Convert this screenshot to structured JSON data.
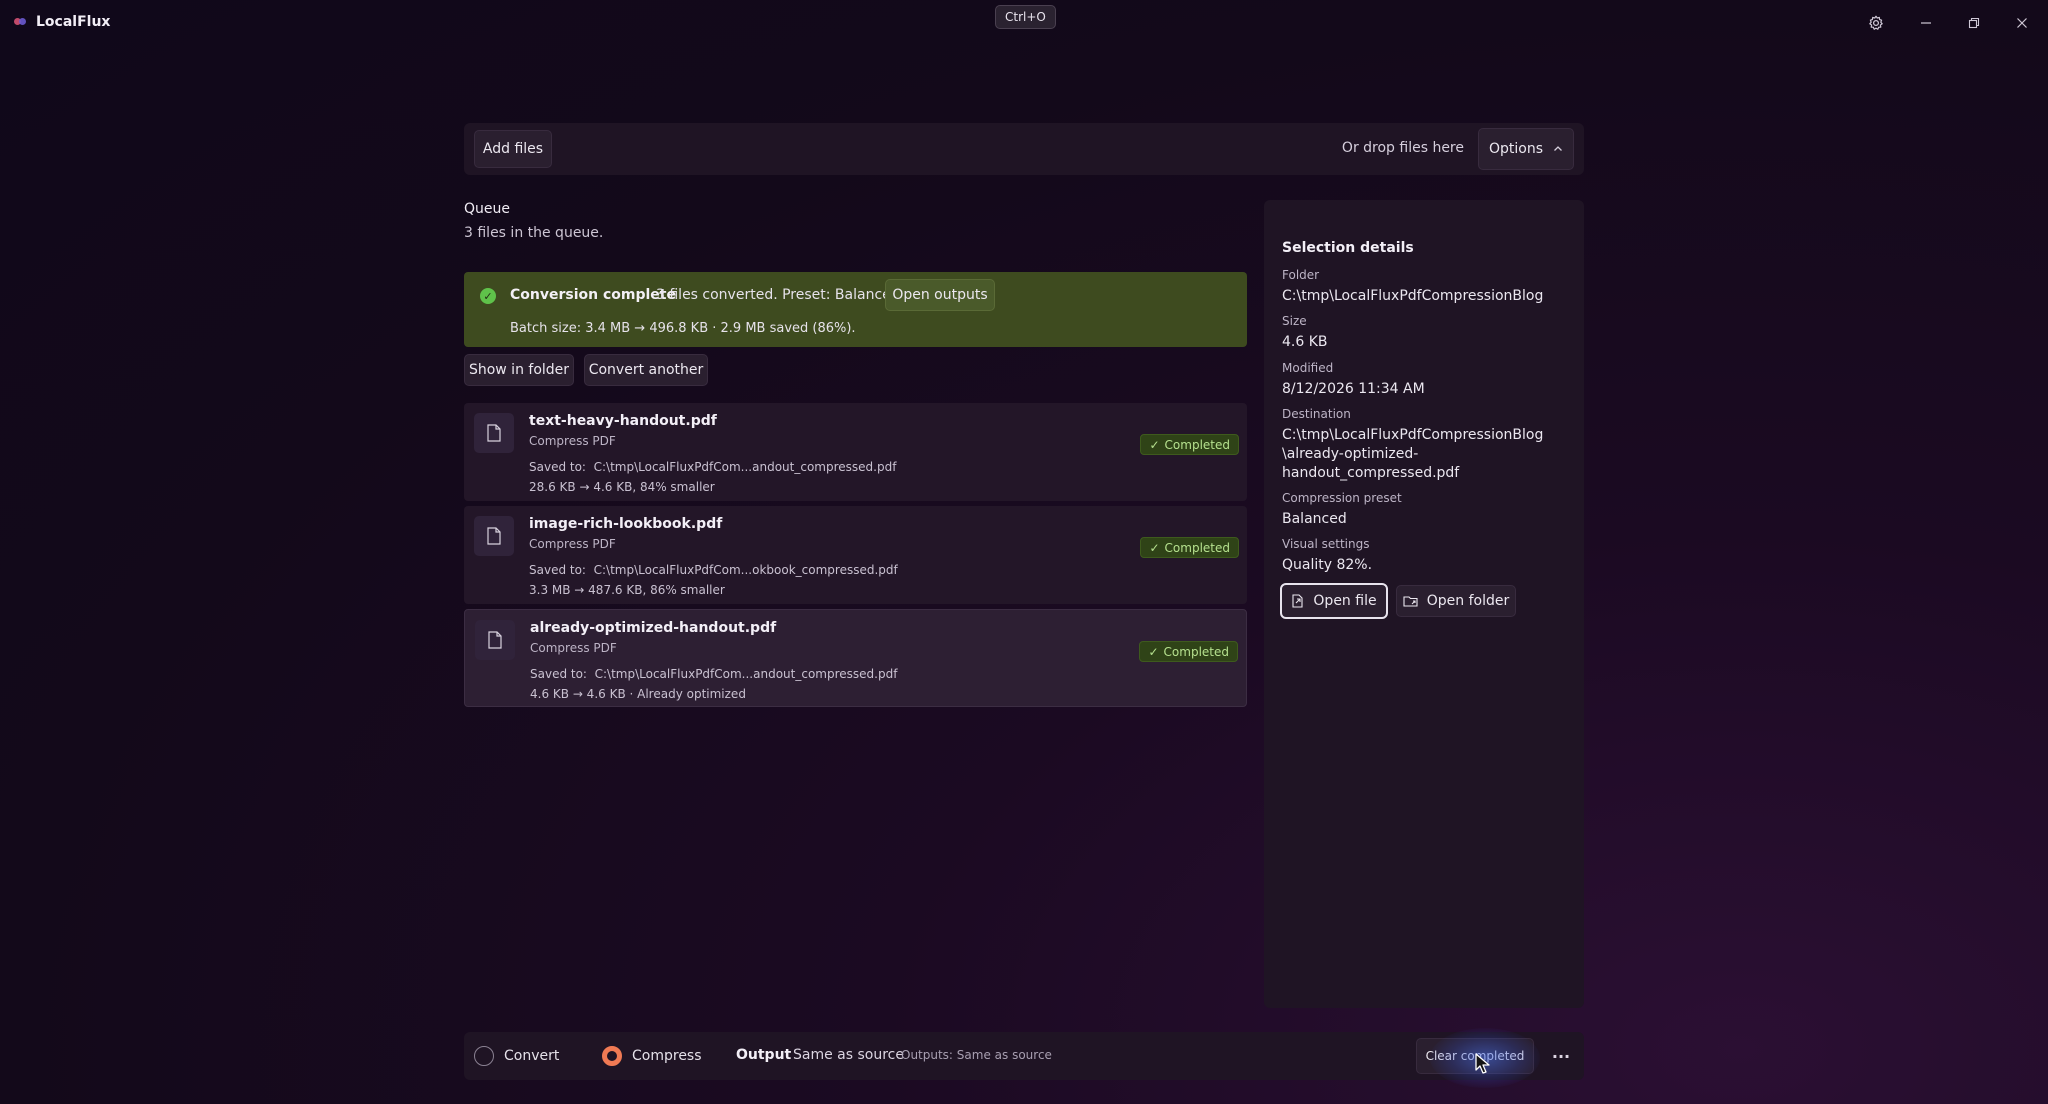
{
  "app": {
    "title": "LocalFlux"
  },
  "tooltip": "Ctrl+O",
  "toolbar": {
    "add_files": "Add files",
    "drop_hint": "Or drop files here",
    "options": "Options"
  },
  "queue": {
    "title": "Queue",
    "subtitle": "3 files in the queue."
  },
  "banner": {
    "title": "Conversion complete",
    "message": "3 files converted. Preset: Balanced.",
    "open_outputs": "Open outputs",
    "batch": "Batch size: 3.4 MB → 496.8 KB · 2.9 MB saved (86%)."
  },
  "actions": {
    "show_in_folder": "Show in folder",
    "convert_another": "Convert another"
  },
  "files": [
    {
      "name": "text-heavy-handout.pdf",
      "action": "Compress PDF",
      "saved_label": "Saved to:",
      "saved_path": "C:\\tmp\\LocalFluxPdfCom...andout_compressed.pdf",
      "size": "28.6 KB → 4.6 KB, 84% smaller",
      "status": "Completed"
    },
    {
      "name": "image-rich-lookbook.pdf",
      "action": "Compress PDF",
      "saved_label": "Saved to:",
      "saved_path": "C:\\tmp\\LocalFluxPdfCom...okbook_compressed.pdf",
      "size": "3.3 MB → 487.6 KB, 86% smaller",
      "status": "Completed"
    },
    {
      "name": "already-optimized-handout.pdf",
      "action": "Compress PDF",
      "saved_label": "Saved to:",
      "saved_path": "C:\\tmp\\LocalFluxPdfCom...andout_compressed.pdf",
      "size": "4.6 KB → 4.6 KB · Already optimized",
      "status": "Completed"
    }
  ],
  "details": {
    "title": "Selection details",
    "folder_label": "Folder",
    "folder": "C:\\tmp\\LocalFluxPdfCompressionBlog",
    "size_label": "Size",
    "size": "4.6 KB",
    "modified_label": "Modified",
    "modified": "8/12/2026 11:34 AM",
    "destination_label": "Destination",
    "destination_1": "C:\\tmp\\LocalFluxPdfCompressionBlog",
    "destination_2": "\\already-optimized-",
    "destination_3": "handout_compressed.pdf",
    "preset_label": "Compression preset",
    "preset": "Balanced",
    "visual_label": "Visual settings",
    "visual": "Quality 82%.",
    "open_file": "Open file",
    "open_folder": "Open folder"
  },
  "bottom": {
    "convert": "Convert",
    "compress": "Compress",
    "output_label": "Output",
    "output_value": "Same as source",
    "outputs_hint": "Outputs: Same as source",
    "clear_completed": "Clear completed",
    "more": "···"
  },
  "colors": {
    "accent_radio": "#f07a54",
    "banner_bg": "#3e4b1f",
    "success": "#5fc24a",
    "badge_text": "#b5e08e"
  }
}
